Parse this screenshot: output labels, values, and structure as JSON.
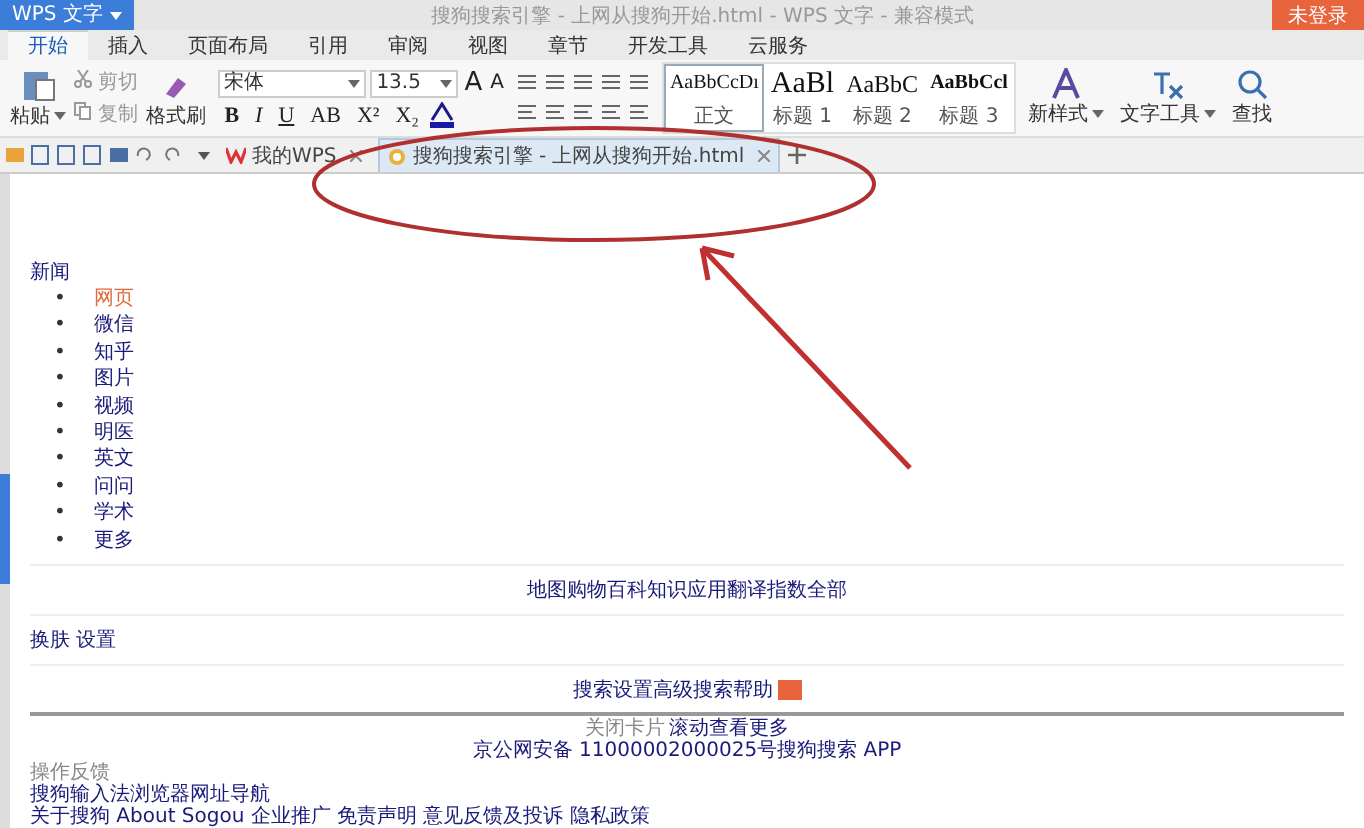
{
  "window": {
    "app_menu": "WPS 文字",
    "title": "搜狗搜索引擎 - 上网从搜狗开始.html - WPS 文字 - 兼容模式",
    "login_button": "未登录"
  },
  "menu_tabs": [
    {
      "label": "开始",
      "selected": true
    },
    {
      "label": "插入",
      "selected": false
    },
    {
      "label": "页面布局",
      "selected": false
    },
    {
      "label": "引用",
      "selected": false
    },
    {
      "label": "审阅",
      "selected": false
    },
    {
      "label": "视图",
      "selected": false
    },
    {
      "label": "章节",
      "selected": false
    },
    {
      "label": "开发工具",
      "selected": false
    },
    {
      "label": "云服务",
      "selected": false
    }
  ],
  "ribbon": {
    "paste": "粘贴",
    "cut": "剪切",
    "copy": "复制",
    "format_painter": "格式刷",
    "font": "宋体",
    "font_size": "13.5",
    "grow_font": "A",
    "shrink_font": "A",
    "format_buttons": [
      {
        "label": "B",
        "kind": "bold"
      },
      {
        "label": "I",
        "kind": "italic"
      },
      {
        "label": "U",
        "kind": "underline"
      },
      {
        "label": "AB",
        "kind": "plain"
      },
      {
        "label": "X²",
        "kind": "plain"
      },
      {
        "label": "X₂",
        "kind": "plain"
      }
    ],
    "styles": [
      {
        "preview": "AaBbCcDı",
        "label": "正文",
        "selected": true
      },
      {
        "preview": "AaBl",
        "label": "标题 1",
        "selected": false
      },
      {
        "preview": "AaBbC",
        "label": "标题 2",
        "selected": false
      },
      {
        "preview": "AaBbCcl",
        "label": "标题 3",
        "selected": false
      }
    ],
    "new_style": "新样式",
    "text_tools": "文字工具",
    "find": "查找"
  },
  "doc_tabs": [
    {
      "label": "我的WPS",
      "selected": false
    },
    {
      "label": "搜狗搜索引擎 - 上网从搜狗开始.html",
      "selected": true
    }
  ],
  "document": {
    "heading": "新闻",
    "nav_items": [
      {
        "marker": "•",
        "label": "网页",
        "selected": true
      },
      {
        "marker": "•",
        "label": "微信",
        "selected": false
      },
      {
        "marker": "•",
        "label": "知乎",
        "selected": false
      },
      {
        "marker": "•",
        "label": "图片",
        "selected": false
      },
      {
        "marker": "•",
        "label": "视频",
        "selected": false
      },
      {
        "marker": "•",
        "label": "明医",
        "selected": false
      },
      {
        "marker": "•",
        "label": "英文",
        "selected": false
      },
      {
        "marker": "•",
        "label": "问问",
        "selected": false
      },
      {
        "marker": "•",
        "label": "学术",
        "selected": false
      },
      {
        "marker": "•",
        "label": "更多",
        "selected": false
      }
    ],
    "more_links": "地图购物百科知识应用翻译指数全部",
    "skin_settings": "换肤 设置",
    "search_links": "搜索设置高级搜索帮助",
    "close_card": "关闭卡片",
    "scroll_more": "滚动查看更多",
    "license": "京公网安备 11000002000025号搜狗搜索 APP",
    "feedback": "操作反馈",
    "nav_links": "搜狗输入法浏览器网址导航",
    "footer": "关于搜狗 About Sogou 企业推广 免责声明 意见反馈及投诉 隐私政策"
  }
}
